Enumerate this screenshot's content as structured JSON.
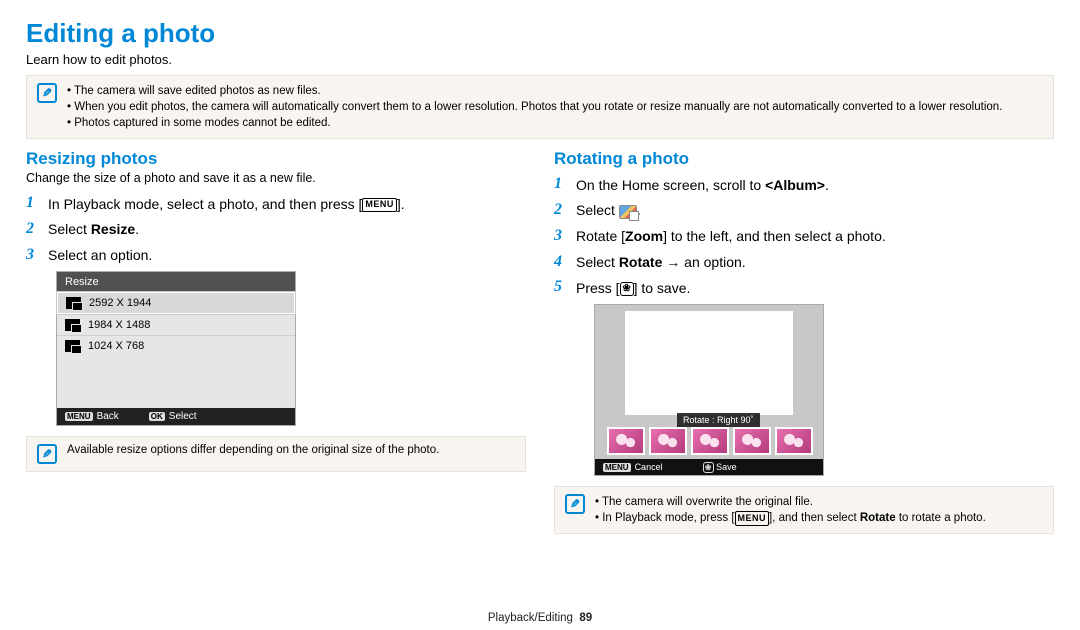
{
  "page_title": "Editing a photo",
  "subtitle": "Learn how to edit photos.",
  "top_notes": [
    "The camera will save edited photos as new files.",
    "When you edit photos, the camera will automatically convert them to a lower resolution. Photos that you rotate or resize manually are not automatically converted to a lower resolution.",
    "Photos captured in some modes cannot be edited."
  ],
  "left": {
    "title": "Resizing photos",
    "subtitle": "Change the size of a photo and save it as a new file.",
    "steps": {
      "s1_pre": "In Playback mode, select a photo, and then press [",
      "s1_post": "].",
      "s2_pre": "Select ",
      "s2_bold": "Resize",
      "s2_post": ".",
      "s3": "Select an option."
    },
    "resize_ui": {
      "header": "Resize",
      "rows": [
        "2592 X 1944",
        "1984 X 1488",
        "1024 X 768"
      ],
      "footer_back_tag": "MENU",
      "footer_back": "Back",
      "footer_select_tag": "OK",
      "footer_select": "Select"
    },
    "footnote": "Available resize options differ depending on the original size of the photo."
  },
  "right": {
    "title": "Rotating a photo",
    "steps": {
      "s1_pre": "On the Home screen, scroll to ",
      "s1_bold": "<Album>",
      "s1_post": ".",
      "s2_pre": "Select ",
      "s2_post": ".",
      "s3_pre": "Rotate [",
      "s3_bold": "Zoom",
      "s3_mid": "] to the left, and then select a photo.",
      "s4_pre": "Select ",
      "s4_bold": "Rotate",
      "s4_post": " → an option.",
      "s5_pre": "Press [",
      "s5_post": "] to save."
    },
    "rotate_ui": {
      "label": "Rotate : Right 90˚",
      "footer_cancel_tag": "MENU",
      "footer_cancel": "Cancel",
      "footer_save": "Save"
    },
    "notes": {
      "n1": "The camera will overwrite the original file.",
      "n2_pre": "In Playback mode, press [",
      "n2_mid": "], and then select ",
      "n2_bold": "Rotate",
      "n2_post": " to rotate a photo."
    }
  },
  "footer": {
    "section": "Playback/Editing",
    "page": "89"
  },
  "labels": {
    "menu": "MENU"
  }
}
